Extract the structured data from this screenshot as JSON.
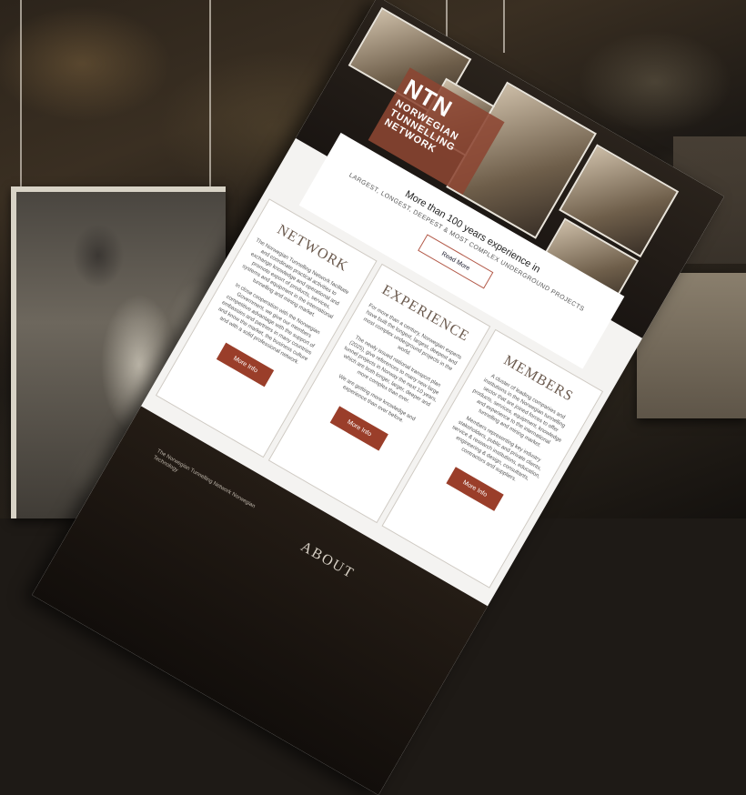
{
  "logo": {
    "abbr": "NTN",
    "line1": "NORWEGIAN",
    "line2": "TUNNELLING",
    "line3": "NETWORK"
  },
  "tagline": {
    "title": "More than 100 years experience in",
    "subtitle": "LARGEST, LONGEST, DEEPEST & MOST COMPLEX UNDERGROUND PROJECTS",
    "button": "Read More"
  },
  "columns": [
    {
      "heading": "NETWORK",
      "paragraphs": [
        "The Norwegian Tunnelling Network facilitate and coordinate practical activities to exchange knowledge and operational and promote export of products, services, systems and equipment in the international tunnelling and mining market.",
        "In close cooperation with the Norwegian Government, we give our members competitive advantage with the support of embassies and partners in many countries and know the market, the business culture and with a solid professional network."
      ],
      "button": "More Info"
    },
    {
      "heading": "EXPERIENCE",
      "paragraphs": [
        "For more than a century, Norwegian experts have built the longest, largest, deepest and most complex underground projects in the world.",
        "The newly issued national transport plan (2025), give references to many new large tunnel projects in Norway the next 10 years, which are both longer, larger, deeper and more complex than ever.",
        "We are getting more knowledge and experience than ever before."
      ],
      "button": "More Info"
    },
    {
      "heading": "MEMBERS",
      "paragraphs": [
        "A cluster of leading companies and institutions in the Norwegian tunnelling sector that are joined forces to offer products, services, equipment, knowledge and experience to the international tunnelling and mining market.",
        "Members representing key industry stakeholders, public and private clients, service & research institutions, education, engineering & design, consultants, contractors and suppliers."
      ],
      "button": "More Info"
    }
  ],
  "footer": {
    "heading": "ABOUT",
    "text": "The Norwegian Tunnelling Network Norwegian Technology"
  },
  "colors": {
    "accent": "#9a3e2a",
    "logo_bg": "#8c4632",
    "paper": "#f4f3f1",
    "rock": "#2c241b"
  }
}
